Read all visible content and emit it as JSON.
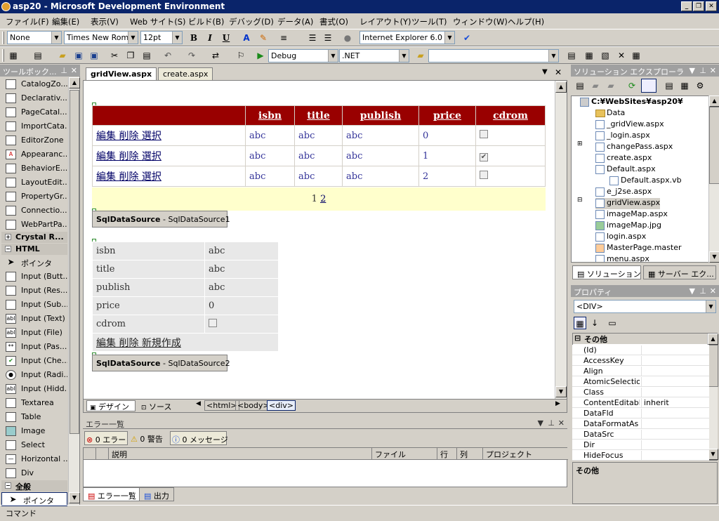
{
  "window": {
    "title": "asp20 - Microsoft Development Environment",
    "minimize": "_",
    "restore": "❐",
    "close": "✕"
  },
  "menu": [
    "ファイル(F)",
    "編集(E)",
    "表示(V)",
    "Web サイト(S)",
    "ビルド(B)",
    "デバッグ(D)",
    "データ(A)",
    "書式(O)",
    "レイアウト(Y)",
    "ツール(T)",
    "ウィンドウ(W)",
    "ヘルプ(H)"
  ],
  "toolbar1": {
    "style": "None",
    "font": "Times New Roma",
    "size": "12pt",
    "bold": "B",
    "italic": "I",
    "underline": "U",
    "browser": "Internet Explorer 6.0"
  },
  "toolbar2": {
    "config": "Debug",
    "platform": ".NET"
  },
  "toolbox": {
    "title": "ツールボック...",
    "items_top": [
      "CatalogZo...",
      "Declarativ...",
      "PageCatal...",
      "ImportCata...",
      "EditorZone",
      "Appearanc...",
      "BehaviorE...",
      "LayoutEdit...",
      "PropertyGr...",
      "Connectio...",
      "WebPartPa..."
    ],
    "cat_crystal": "Crystal R...",
    "cat_html": "HTML",
    "items_html": [
      "ポインタ",
      "Input (Butt...",
      "Input (Res...",
      "Input (Sub...",
      "Input (Text)",
      "Input (File)",
      "Input (Pas...",
      "Input (Che...",
      "Input (Radi...",
      "Input (Hidd...",
      "Textarea",
      "Table",
      "Image",
      "Select",
      "Horizontal ...",
      "Div"
    ],
    "cat_all": "全般",
    "item_all": "ポインタ"
  },
  "tabs": [
    "gridView.aspx",
    "create.aspx"
  ],
  "gridview": {
    "headers": [
      "isbn",
      "title",
      "publish",
      "price",
      "cdrom"
    ],
    "links": [
      "編集",
      "削除",
      "選択"
    ],
    "rows": [
      {
        "isbn": "abc",
        "title": "abc",
        "publish": "abc",
        "price": "0",
        "cdrom": false
      },
      {
        "isbn": "abc",
        "title": "abc",
        "publish": "abc",
        "price": "1",
        "cdrom": true
      },
      {
        "isbn": "abc",
        "title": "abc",
        "publish": "abc",
        "price": "2",
        "cdrom": false
      }
    ],
    "pager_current": "1",
    "pager_next": "2"
  },
  "ds1": {
    "type": "SqlDataSource",
    "sep": " - ",
    "name": "SqlDataSource1"
  },
  "detailsview": {
    "rows": [
      {
        "label": "isbn",
        "value": "abc"
      },
      {
        "label": "title",
        "value": "abc"
      },
      {
        "label": "publish",
        "value": "abc"
      },
      {
        "label": "price",
        "value": "0"
      },
      {
        "label": "cdrom",
        "value": ""
      }
    ],
    "links": [
      "編集",
      "削除",
      "新規作成"
    ]
  },
  "ds2": {
    "type": "SqlDataSource",
    "sep": " - ",
    "name": "SqlDataSource2"
  },
  "viewtabs": {
    "design": "デザイン",
    "source": "ソース",
    "tags": [
      "<html>",
      "<body>",
      "<div>"
    ]
  },
  "errorlist": {
    "title": "エラー一覧",
    "errors": "0 エラー",
    "warnings": "0 警告",
    "messages": "0 メッセージ",
    "columns": [
      "説明",
      "ファイル",
      "行",
      "列",
      "プロジェクト"
    ]
  },
  "bottomtabs": [
    "エラー一覧",
    "出力"
  ],
  "status": "コマンド",
  "solution": {
    "title": "ソリューション エクスプローラ",
    "root": "C:¥WebSites¥asp20¥",
    "items": [
      "Data",
      "_gridView.aspx",
      "_login.aspx",
      "changePass.aspx",
      "create.aspx",
      "Default.aspx",
      "Default.aspx.vb",
      "e_j2se.aspx",
      "gridView.aspx",
      "imageMap.aspx",
      "imageMap.jpg",
      "login.aspx",
      "MasterPage.master",
      "menu.aspx"
    ],
    "tab1": "ソリューション ...",
    "tab2": "サーバー エク..."
  },
  "properties": {
    "title": "プロパティ",
    "object": "<DIV>",
    "category": "その他",
    "rows": [
      {
        "name": "(Id)",
        "value": ""
      },
      {
        "name": "AccessKey",
        "value": ""
      },
      {
        "name": "Align",
        "value": ""
      },
      {
        "name": "AtomicSelection",
        "value": ""
      },
      {
        "name": "Class",
        "value": ""
      },
      {
        "name": "ContentEditable",
        "value": "inherit"
      },
      {
        "name": "DataFld",
        "value": ""
      },
      {
        "name": "DataFormatAs",
        "value": ""
      },
      {
        "name": "DataSrc",
        "value": ""
      },
      {
        "name": "Dir",
        "value": ""
      },
      {
        "name": "HideFocus",
        "value": ""
      }
    ],
    "desc_title": "その他"
  }
}
